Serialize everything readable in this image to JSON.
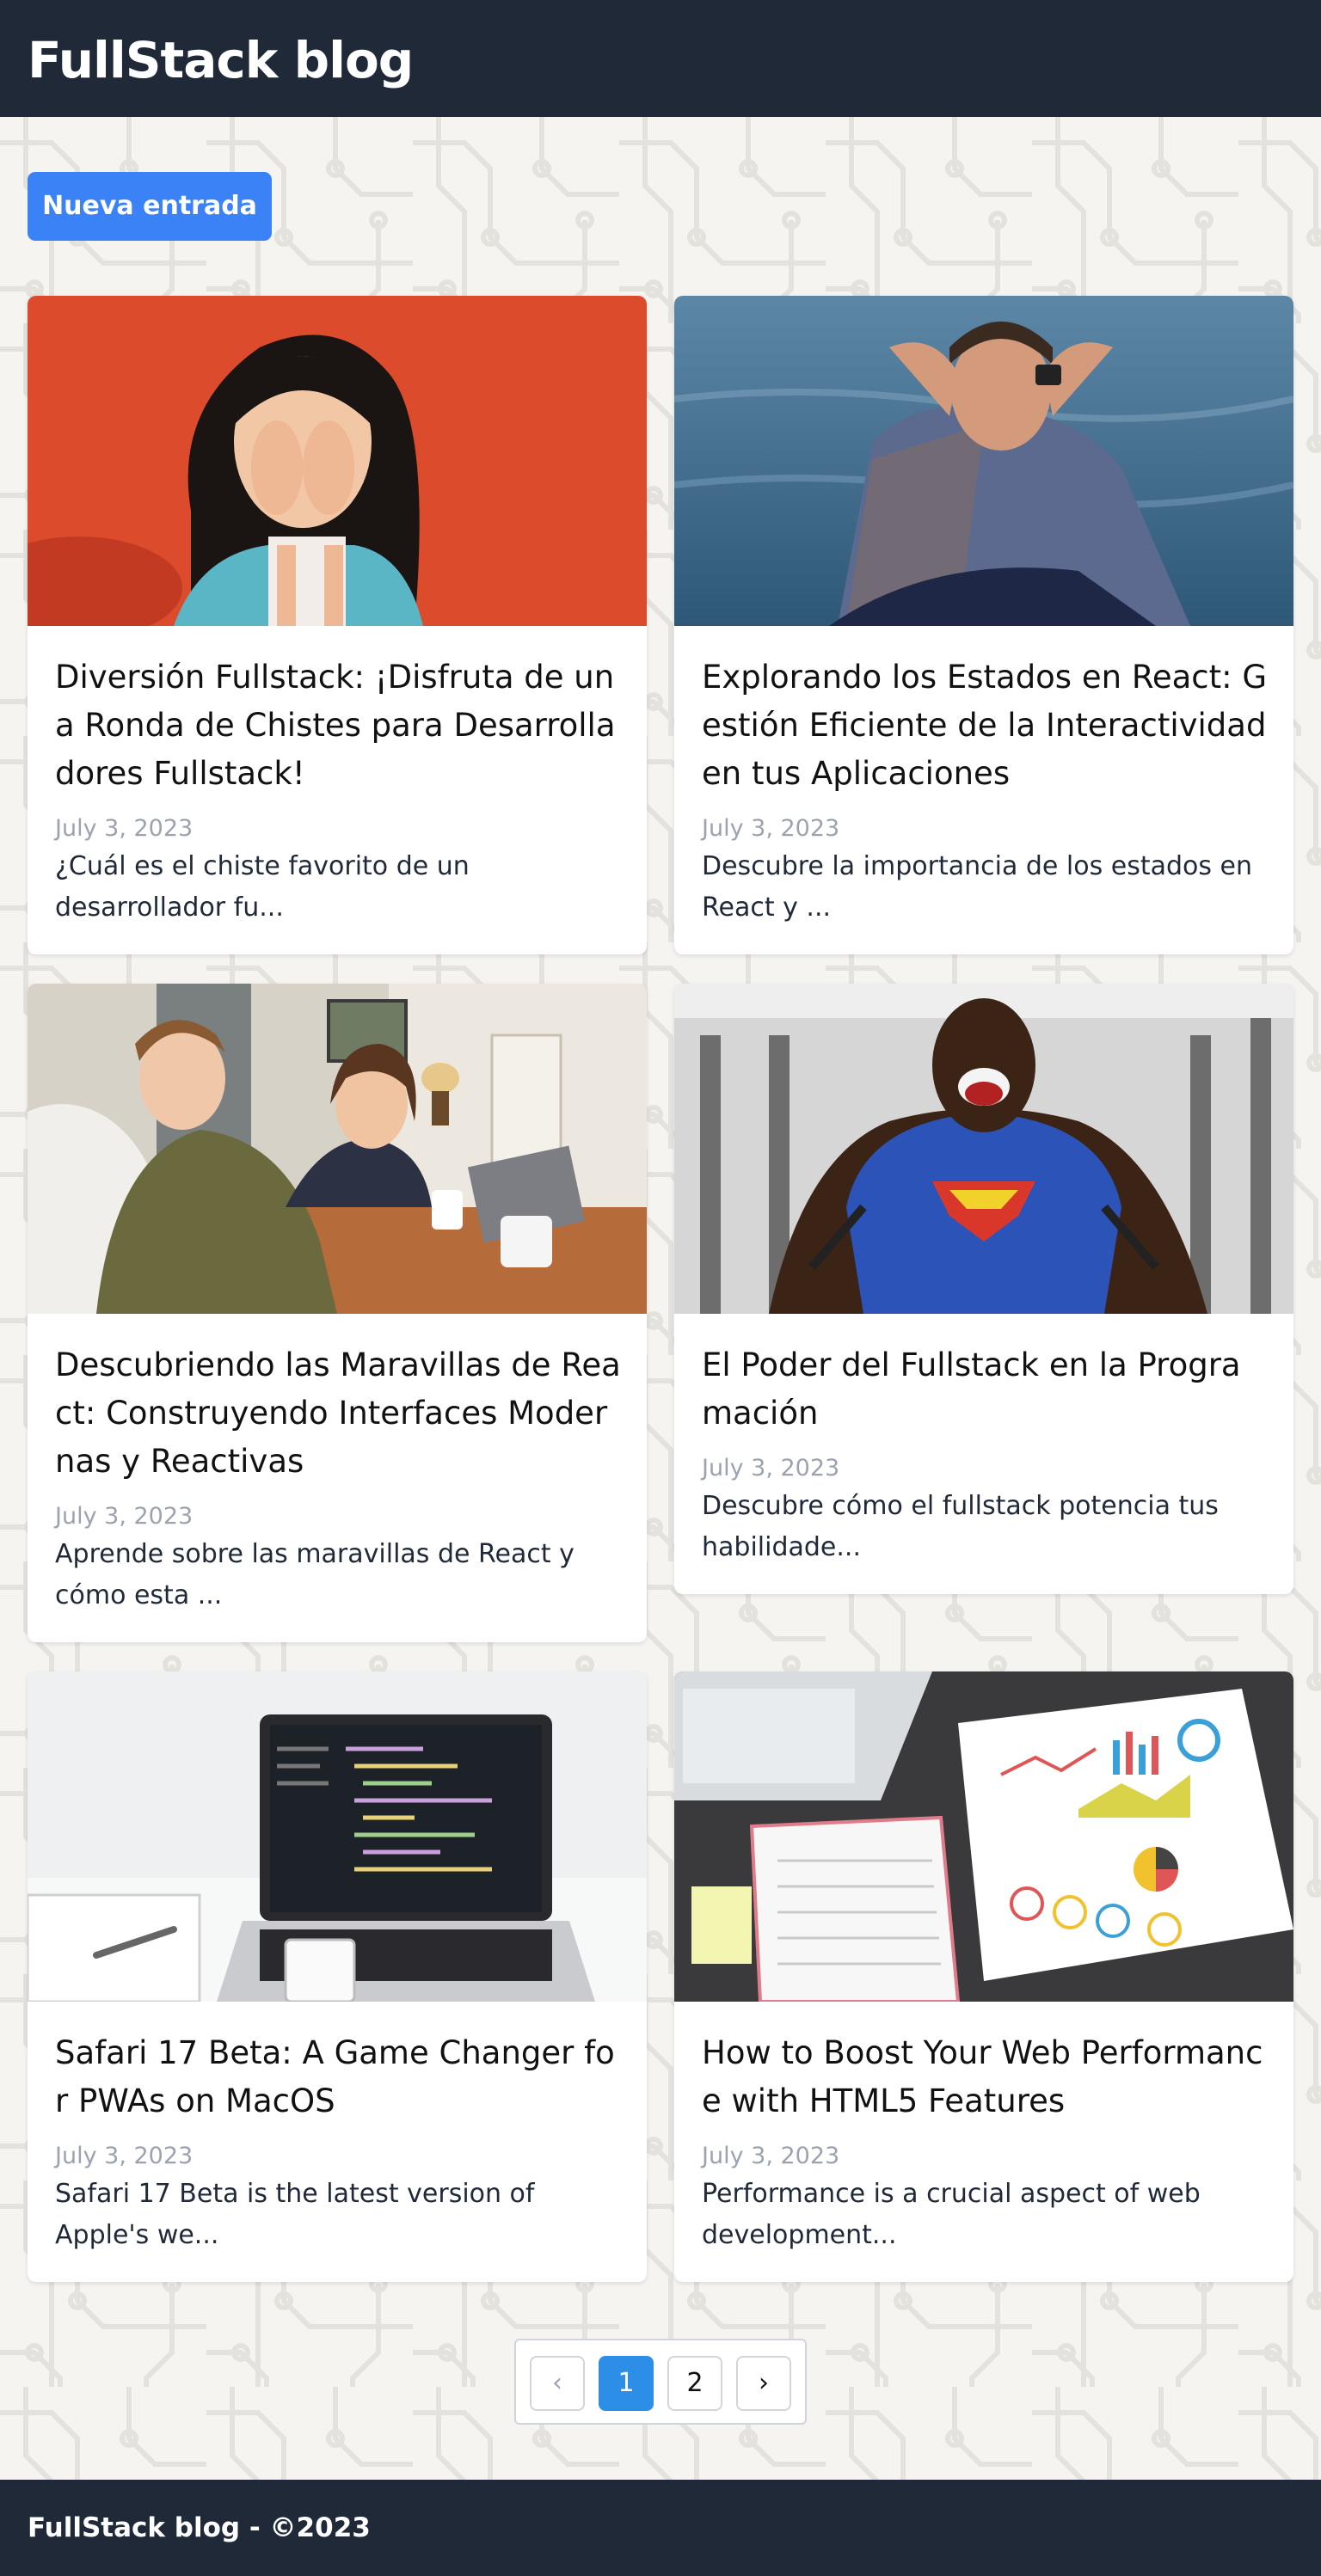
{
  "header": {
    "title": "FullStack blog"
  },
  "actions": {
    "new_post_label": "Nueva entrada"
  },
  "posts": [
    {
      "title": "Diversión Fullstack: ¡Disfruta de una Ronda de Chistes para Desarrolladores Fullstack!",
      "date": "July 3, 2023",
      "excerpt": "¿Cuál es el chiste favorito de un desarrollador fu...",
      "image_icon": "laughing-woman-photo"
    },
    {
      "title": "Explorando los Estados en React: Gestión Eficiente de la Interactividad en tus Aplicaciones",
      "date": "July 3, 2023",
      "excerpt": "Descubre la importancia de los estados en React y ...",
      "image_icon": "stressed-man-photo"
    },
    {
      "title": "Descubriendo las Maravillas de React: Construyendo Interfaces Modernas y Reactivas",
      "date": "July 3, 2023",
      "excerpt": "Aprende sobre las maravillas de React y cómo esta ...",
      "image_icon": "women-at-laptop-photo"
    },
    {
      "title": "El Poder del Fullstack en la Programación",
      "date": "July 3, 2023",
      "excerpt": "Descubre cómo el fullstack potencia tus habilidade...",
      "image_icon": "superman-gym-photo"
    },
    {
      "title": "Safari 17 Beta: A Game Changer for PWAs on MacOS",
      "date": "July 3, 2023",
      "excerpt": "Safari 17 Beta is the latest version of Apple's we...",
      "image_icon": "laptop-code-photo"
    },
    {
      "title": "How to Boost Your Web Performance with HTML5 Features",
      "date": "July 3, 2023",
      "excerpt": "Performance is a crucial aspect of web development...",
      "image_icon": "charts-report-photo"
    }
  ],
  "pagination": {
    "prev_label": "‹",
    "pages": [
      "1",
      "2"
    ],
    "current": "1",
    "next_label": "›"
  },
  "footer": {
    "text": "FullStack blog - ©2023"
  },
  "colors": {
    "header_bg": "#1f2937",
    "primary": "#3b82f6",
    "active_page": "#2d8ee8"
  }
}
